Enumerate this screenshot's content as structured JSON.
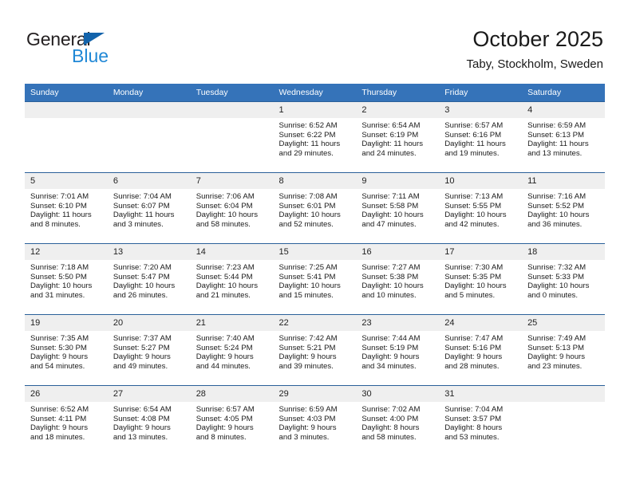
{
  "brand": {
    "name_part1": "General",
    "name_part2": "Blue",
    "triangle_color": "#1263ab",
    "blue_color": "#2088d6"
  },
  "header": {
    "month_title": "October 2025",
    "location": "Taby, Stockholm, Sweden"
  },
  "theme": {
    "header_bg": "#3573b9",
    "week_rule": "#2a6099",
    "daynum_bg": "#efefef"
  },
  "calendar": {
    "weekdays": [
      "Sunday",
      "Monday",
      "Tuesday",
      "Wednesday",
      "Thursday",
      "Friday",
      "Saturday"
    ],
    "weeks": [
      [
        {
          "day": "",
          "lines": []
        },
        {
          "day": "",
          "lines": []
        },
        {
          "day": "",
          "lines": []
        },
        {
          "day": "1",
          "lines": [
            "Sunrise: 6:52 AM",
            "Sunset: 6:22 PM",
            "Daylight: 11 hours",
            "and 29 minutes."
          ]
        },
        {
          "day": "2",
          "lines": [
            "Sunrise: 6:54 AM",
            "Sunset: 6:19 PM",
            "Daylight: 11 hours",
            "and 24 minutes."
          ]
        },
        {
          "day": "3",
          "lines": [
            "Sunrise: 6:57 AM",
            "Sunset: 6:16 PM",
            "Daylight: 11 hours",
            "and 19 minutes."
          ]
        },
        {
          "day": "4",
          "lines": [
            "Sunrise: 6:59 AM",
            "Sunset: 6:13 PM",
            "Daylight: 11 hours",
            "and 13 minutes."
          ]
        }
      ],
      [
        {
          "day": "5",
          "lines": [
            "Sunrise: 7:01 AM",
            "Sunset: 6:10 PM",
            "Daylight: 11 hours",
            "and 8 minutes."
          ]
        },
        {
          "day": "6",
          "lines": [
            "Sunrise: 7:04 AM",
            "Sunset: 6:07 PM",
            "Daylight: 11 hours",
            "and 3 minutes."
          ]
        },
        {
          "day": "7",
          "lines": [
            "Sunrise: 7:06 AM",
            "Sunset: 6:04 PM",
            "Daylight: 10 hours",
            "and 58 minutes."
          ]
        },
        {
          "day": "8",
          "lines": [
            "Sunrise: 7:08 AM",
            "Sunset: 6:01 PM",
            "Daylight: 10 hours",
            "and 52 minutes."
          ]
        },
        {
          "day": "9",
          "lines": [
            "Sunrise: 7:11 AM",
            "Sunset: 5:58 PM",
            "Daylight: 10 hours",
            "and 47 minutes."
          ]
        },
        {
          "day": "10",
          "lines": [
            "Sunrise: 7:13 AM",
            "Sunset: 5:55 PM",
            "Daylight: 10 hours",
            "and 42 minutes."
          ]
        },
        {
          "day": "11",
          "lines": [
            "Sunrise: 7:16 AM",
            "Sunset: 5:52 PM",
            "Daylight: 10 hours",
            "and 36 minutes."
          ]
        }
      ],
      [
        {
          "day": "12",
          "lines": [
            "Sunrise: 7:18 AM",
            "Sunset: 5:50 PM",
            "Daylight: 10 hours",
            "and 31 minutes."
          ]
        },
        {
          "day": "13",
          "lines": [
            "Sunrise: 7:20 AM",
            "Sunset: 5:47 PM",
            "Daylight: 10 hours",
            "and 26 minutes."
          ]
        },
        {
          "day": "14",
          "lines": [
            "Sunrise: 7:23 AM",
            "Sunset: 5:44 PM",
            "Daylight: 10 hours",
            "and 21 minutes."
          ]
        },
        {
          "day": "15",
          "lines": [
            "Sunrise: 7:25 AM",
            "Sunset: 5:41 PM",
            "Daylight: 10 hours",
            "and 15 minutes."
          ]
        },
        {
          "day": "16",
          "lines": [
            "Sunrise: 7:27 AM",
            "Sunset: 5:38 PM",
            "Daylight: 10 hours",
            "and 10 minutes."
          ]
        },
        {
          "day": "17",
          "lines": [
            "Sunrise: 7:30 AM",
            "Sunset: 5:35 PM",
            "Daylight: 10 hours",
            "and 5 minutes."
          ]
        },
        {
          "day": "18",
          "lines": [
            "Sunrise: 7:32 AM",
            "Sunset: 5:33 PM",
            "Daylight: 10 hours",
            "and 0 minutes."
          ]
        }
      ],
      [
        {
          "day": "19",
          "lines": [
            "Sunrise: 7:35 AM",
            "Sunset: 5:30 PM",
            "Daylight: 9 hours",
            "and 54 minutes."
          ]
        },
        {
          "day": "20",
          "lines": [
            "Sunrise: 7:37 AM",
            "Sunset: 5:27 PM",
            "Daylight: 9 hours",
            "and 49 minutes."
          ]
        },
        {
          "day": "21",
          "lines": [
            "Sunrise: 7:40 AM",
            "Sunset: 5:24 PM",
            "Daylight: 9 hours",
            "and 44 minutes."
          ]
        },
        {
          "day": "22",
          "lines": [
            "Sunrise: 7:42 AM",
            "Sunset: 5:21 PM",
            "Daylight: 9 hours",
            "and 39 minutes."
          ]
        },
        {
          "day": "23",
          "lines": [
            "Sunrise: 7:44 AM",
            "Sunset: 5:19 PM",
            "Daylight: 9 hours",
            "and 34 minutes."
          ]
        },
        {
          "day": "24",
          "lines": [
            "Sunrise: 7:47 AM",
            "Sunset: 5:16 PM",
            "Daylight: 9 hours",
            "and 28 minutes."
          ]
        },
        {
          "day": "25",
          "lines": [
            "Sunrise: 7:49 AM",
            "Sunset: 5:13 PM",
            "Daylight: 9 hours",
            "and 23 minutes."
          ]
        }
      ],
      [
        {
          "day": "26",
          "lines": [
            "Sunrise: 6:52 AM",
            "Sunset: 4:11 PM",
            "Daylight: 9 hours",
            "and 18 minutes."
          ]
        },
        {
          "day": "27",
          "lines": [
            "Sunrise: 6:54 AM",
            "Sunset: 4:08 PM",
            "Daylight: 9 hours",
            "and 13 minutes."
          ]
        },
        {
          "day": "28",
          "lines": [
            "Sunrise: 6:57 AM",
            "Sunset: 4:05 PM",
            "Daylight: 9 hours",
            "and 8 minutes."
          ]
        },
        {
          "day": "29",
          "lines": [
            "Sunrise: 6:59 AM",
            "Sunset: 4:03 PM",
            "Daylight: 9 hours",
            "and 3 minutes."
          ]
        },
        {
          "day": "30",
          "lines": [
            "Sunrise: 7:02 AM",
            "Sunset: 4:00 PM",
            "Daylight: 8 hours",
            "and 58 minutes."
          ]
        },
        {
          "day": "31",
          "lines": [
            "Sunrise: 7:04 AM",
            "Sunset: 3:57 PM",
            "Daylight: 8 hours",
            "and 53 minutes."
          ]
        },
        {
          "day": "",
          "lines": []
        }
      ]
    ]
  }
}
